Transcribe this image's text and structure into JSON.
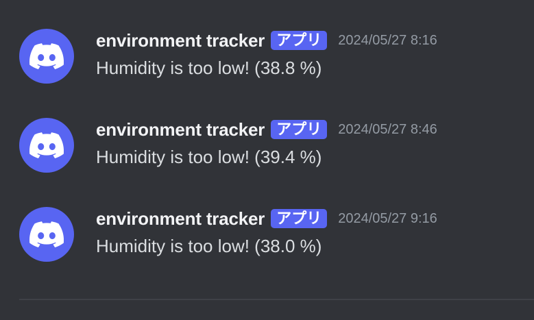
{
  "colors": {
    "background": "#313338",
    "accent": "#5865f2",
    "username": "#f2f3f5",
    "message_text": "#dbdee1",
    "timestamp": "#949ba4"
  },
  "messages": [
    {
      "avatar_icon": "discord-logo-icon",
      "username": "environment tracker",
      "badge": "アプリ",
      "timestamp": "2024/05/27 8:16",
      "content": "Humidity is too low! (38.8 %)"
    },
    {
      "avatar_icon": "discord-logo-icon",
      "username": "environment tracker",
      "badge": "アプリ",
      "timestamp": "2024/05/27 8:46",
      "content": "Humidity is too low! (39.4 %)"
    },
    {
      "avatar_icon": "discord-logo-icon",
      "username": "environment tracker",
      "badge": "アプリ",
      "timestamp": "2024/05/27 9:16",
      "content": "Humidity is too low! (38.0 %)"
    }
  ]
}
